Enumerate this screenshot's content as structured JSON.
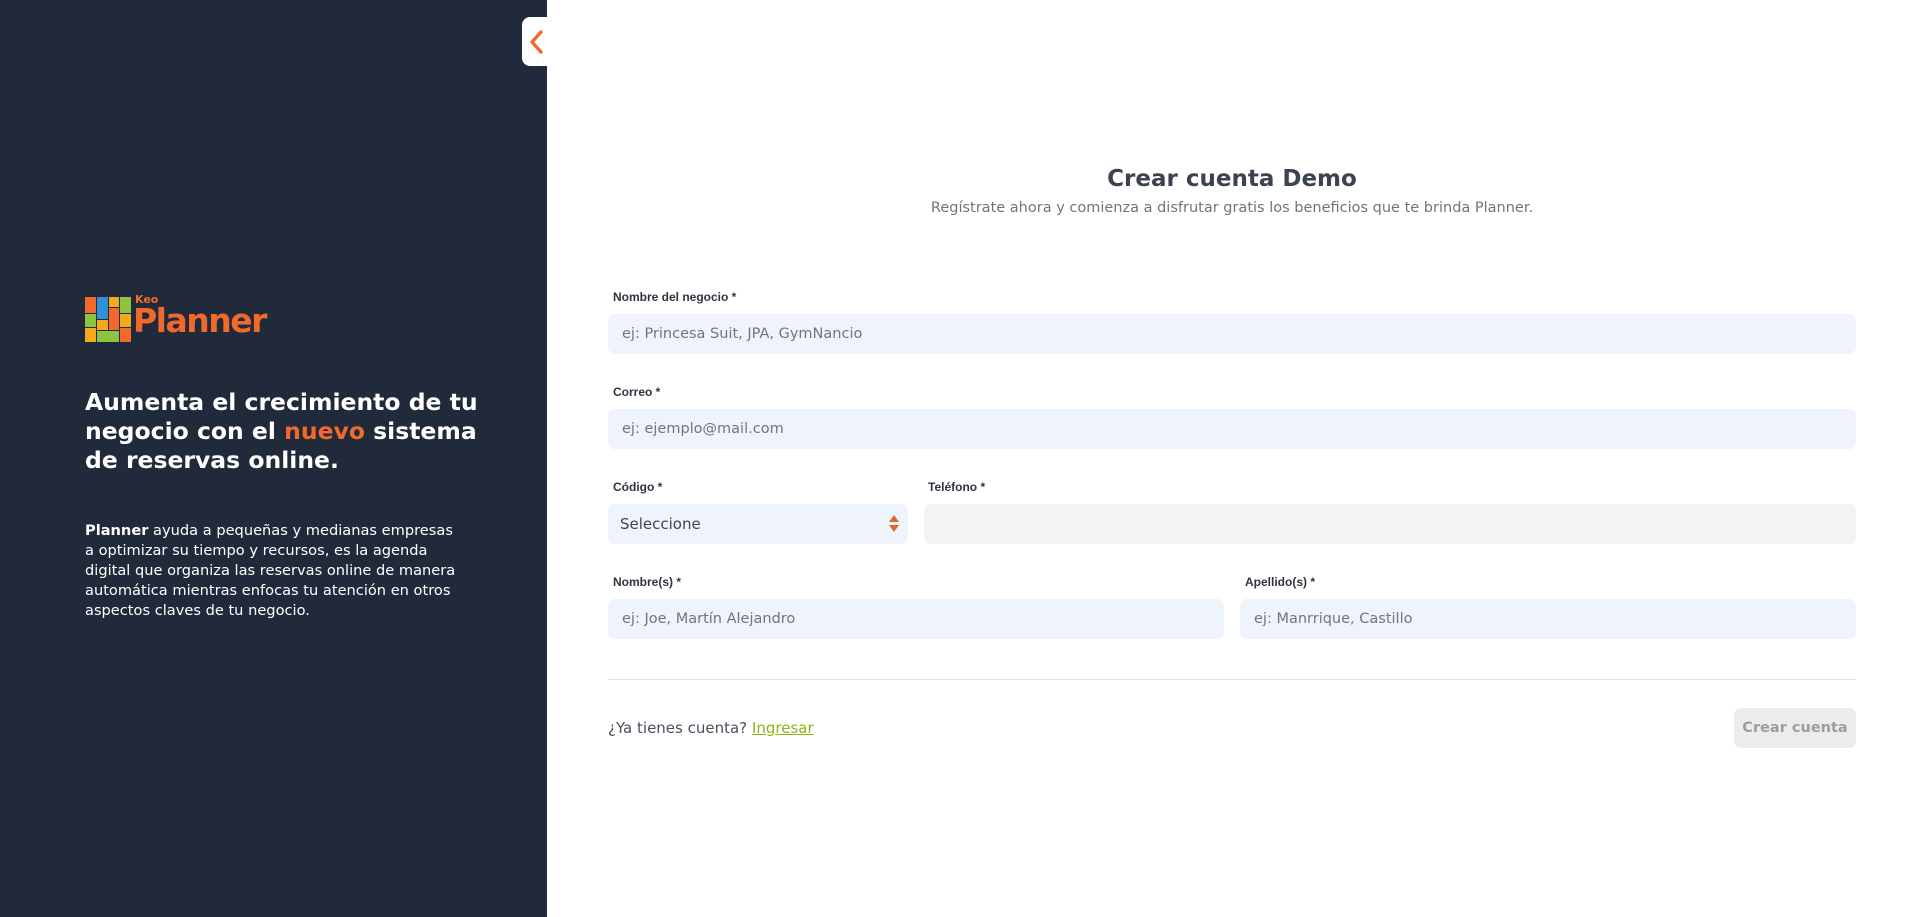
{
  "brand": {
    "name_small": "Keo",
    "name_large": "Planner",
    "accent_color": "#f26a2b"
  },
  "left": {
    "headline_part1": "Aumenta el crecimiento de tu negocio con el ",
    "headline_accent": "nuevo",
    "headline_part2": " sistema de reservas online.",
    "desc_bold": "Planner",
    "desc_rest": " ayuda a pequeñas y medianas empresas a optimizar su tiempo y recursos, es la agenda digital que organiza las reservas online de manera automática mientras enfocas tu atención en otros aspectos claves de tu negocio."
  },
  "collapse_icon": "chevron-left-icon",
  "form": {
    "title": "Crear cuenta Demo",
    "subtitle": "Regístrate ahora y comienza a disfrutar gratis los beneficios que te brinda Planner.",
    "business_label": "Nombre del negocio *",
    "business_placeholder": "ej: Princesa Suit, JPA, GymNancio",
    "email_label": "Correo *",
    "email_placeholder": "ej: ejemplo@mail.com",
    "code_label": "Código *",
    "code_value": "Seleccione",
    "phone_label": "Teléfono *",
    "firstname_label": "Nombre(s) *",
    "firstname_placeholder": "ej: Joe, Martín Alejandro",
    "lastname_label": "Apellido(s) *",
    "lastname_placeholder": "ej: Manrrique, Castillo",
    "have_account_text": "¿Ya tienes cuenta?",
    "login_link": "Ingresar",
    "submit_label": "Crear cuenta"
  }
}
